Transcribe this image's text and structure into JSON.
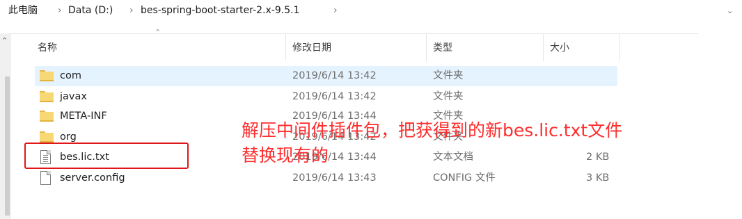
{
  "breadcrumb": {
    "items": [
      "此电脑",
      "Data (D:)",
      "bes-spring-boot-starter-2.x-9.5.1"
    ],
    "separator": "›"
  },
  "columns": {
    "name": "名称",
    "date": "修改日期",
    "type": "类型",
    "size": "大小"
  },
  "rows": [
    {
      "name": "com",
      "date": "2019/6/14 13:42",
      "type": "文件夹",
      "size": "",
      "icon": "folder-icon"
    },
    {
      "name": "javax",
      "date": "2019/6/14 13:42",
      "type": "文件夹",
      "size": "",
      "icon": "folder-icon"
    },
    {
      "name": "META-INF",
      "date": "2019/6/14 13:44",
      "type": "文件夹",
      "size": "",
      "icon": "folder-icon"
    },
    {
      "name": "org",
      "date": "2019/6/14 13:42",
      "type": "文件夹",
      "size": "",
      "icon": "folder-icon"
    },
    {
      "name": "bes.lic.txt",
      "date": "2019/6/14 13:44",
      "type": "文本文档",
      "size": "2 KB",
      "icon": "text-file-icon"
    },
    {
      "name": "server.config",
      "date": "2019/6/14 13:43",
      "type": "CONFIG 文件",
      "size": "3 KB",
      "icon": "file-icon"
    }
  ],
  "annotation": {
    "line1": "解压中间件插件包，把获得到的新bes.lic.txt文件",
    "line2": "替换现有的"
  },
  "colors": {
    "annotation": "#ff2d2d",
    "highlight_box": "#e0161b",
    "selected_row": "#e5f3ff"
  }
}
